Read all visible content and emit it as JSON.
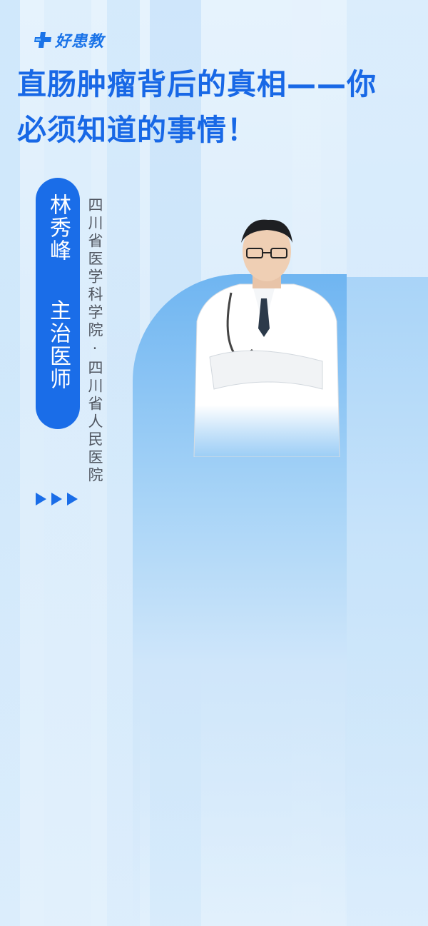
{
  "brand": {
    "logo_text": "好患教",
    "color": "#1a73e8"
  },
  "headline": {
    "line1": "直肠肿瘤背后的真相——你",
    "line2": "必须知道的事情！"
  },
  "doctor": {
    "name": "林秀峰",
    "title": "主治医师",
    "hospital": "四川省医学科学院·四川省人民医院"
  },
  "colors": {
    "accent": "#1a6de8",
    "headline": "#1868e6",
    "background": "#e3f1fc"
  },
  "icons": {
    "logo": "plus-cross-icon",
    "arrows": "triangle-right-icon"
  }
}
